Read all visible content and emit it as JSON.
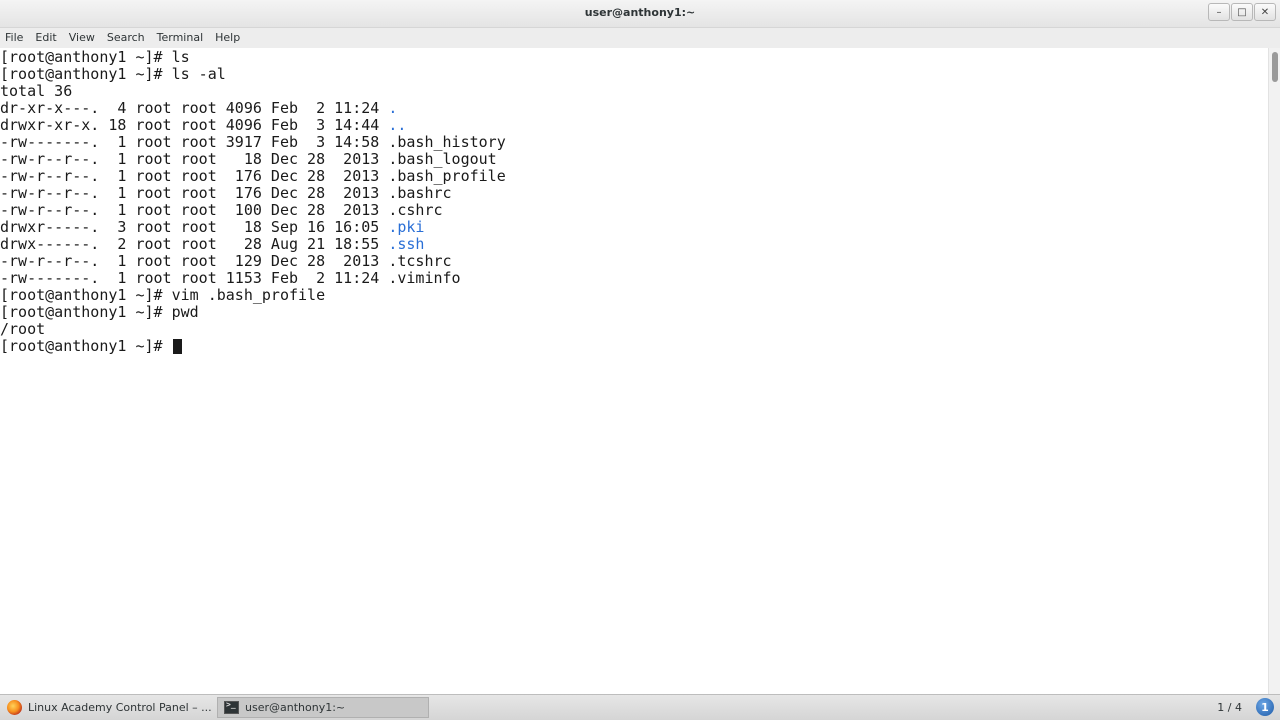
{
  "window": {
    "title": "user@anthony1:~",
    "minimize_glyph": "–",
    "maximize_glyph": "□",
    "close_glyph": "✕"
  },
  "menu": [
    "File",
    "Edit",
    "View",
    "Search",
    "Terminal",
    "Help"
  ],
  "terminal": {
    "lines": [
      "[root@anthony1 ~]# ls",
      "[root@anthony1 ~]# ls -al",
      "total 36",
      "dr-xr-x---.  4 root root 4096 Feb  2 11:24 ",
      "drwxr-xr-x. 18 root root 4096 Feb  3 14:44 ",
      "-rw-------.  1 root root 3917 Feb  3 14:58 .bash_history",
      "-rw-r--r--.  1 root root   18 Dec 28  2013 .bash_logout",
      "-rw-r--r--.  1 root root  176 Dec 28  2013 .bash_profile",
      "-rw-r--r--.  1 root root  176 Dec 28  2013 .bashrc",
      "-rw-r--r--.  1 root root  100 Dec 28  2013 .cshrc",
      "drwxr-----.  3 root root   18 Sep 16 16:05 ",
      "drwx------.  2 root root   28 Aug 21 18:55 ",
      "-rw-r--r--.  1 root root  129 Dec 28  2013 .tcshrc",
      "-rw-------.  1 root root 1153 Feb  2 11:24 .viminfo",
      "[root@anthony1 ~]# vim .bash_profile",
      "[root@anthony1 ~]# pwd",
      "/root",
      "[root@anthony1 ~]# "
    ],
    "dir_names": {
      "3": ".",
      "4": "..",
      "10": ".pki",
      "11": ".ssh"
    },
    "dir_color": "#2a6fd6",
    "text_color": "#1a1a1a",
    "background": "#ffffff"
  },
  "taskbar": {
    "tasks": [
      "Linux Academy Control Panel – ...",
      "user@anthony1:~"
    ],
    "task_icons": [
      "firefox-icon",
      "terminal-icon"
    ],
    "pager": "1 / 4",
    "notify_count": "1"
  }
}
